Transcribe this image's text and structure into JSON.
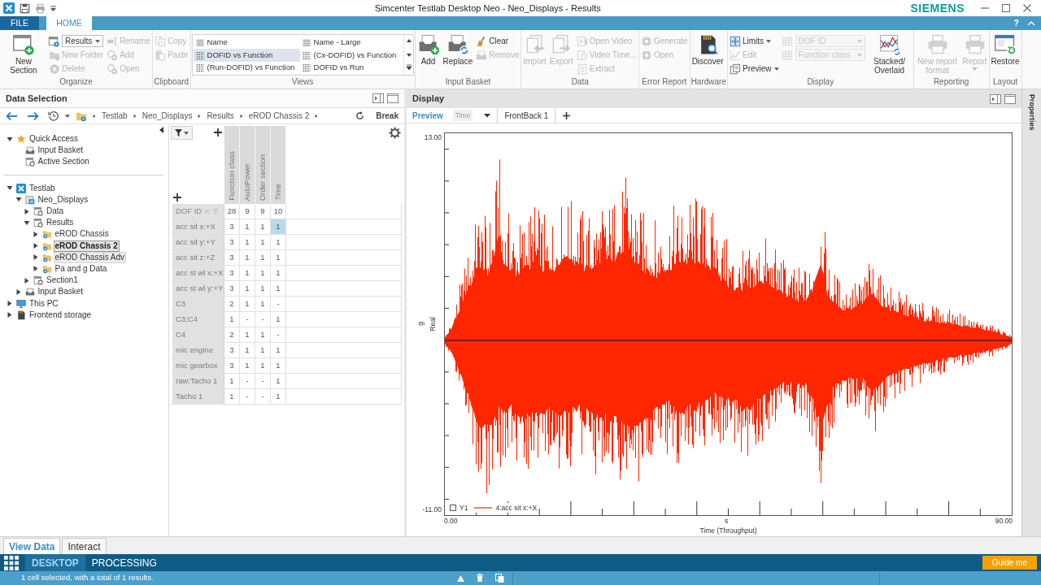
{
  "window": {
    "title": "Simcenter Testlab Desktop Neo - Neo_Displays - Results",
    "brand": "SIEMENS"
  },
  "ribbon": {
    "tabs": [
      {
        "label": "FILE",
        "kind": "file",
        "selected": false
      },
      {
        "label": "HOME",
        "kind": "tab",
        "selected": true
      }
    ],
    "help": "?",
    "groups": [
      {
        "label": "Organize",
        "controls": [
          {
            "kind": "large",
            "label": "New Section",
            "disabled": false
          },
          {
            "kind": "column",
            "items": [
              {
                "kind": "dropdown",
                "value": "Results",
                "disabled": false
              },
              {
                "kind": "small",
                "label": "New Folder",
                "disabled": true
              },
              {
                "kind": "small",
                "label": "Delete",
                "disabled": true
              }
            ]
          },
          {
            "kind": "column",
            "items": [
              {
                "kind": "small",
                "label": "Rename",
                "disabled": true
              },
              {
                "kind": "small",
                "label": "Add",
                "disabled": true
              },
              {
                "kind": "small",
                "label": "Open",
                "disabled": true
              }
            ]
          }
        ]
      },
      {
        "label": "Clipboard",
        "controls": [
          {
            "kind": "column",
            "items": [
              {
                "kind": "small",
                "label": "Copy",
                "disabled": true
              },
              {
                "kind": "small",
                "label": "Paste",
                "disabled": true
              }
            ]
          }
        ]
      },
      {
        "label": "Views",
        "controls": [
          {
            "kind": "gallery",
            "items": [
              {
                "kind": "list",
                "label": "Name",
                "selected": false
              },
              {
                "kind": "list",
                "label": "Name - Large",
                "selected": false
              },
              {
                "kind": "grid",
                "label": "DOFID vs Function",
                "selected": true
              },
              {
                "kind": "grid",
                "label": "(Cx-DOFID) vs Function",
                "selected": false
              },
              {
                "kind": "grid",
                "label": "(Run-DOFID) vs Function",
                "selected": false
              },
              {
                "kind": "grid",
                "label": "DOFID vs Run",
                "selected": false
              }
            ]
          }
        ]
      },
      {
        "label": "Input Basket",
        "controls": [
          {
            "kind": "large",
            "label": "Add",
            "disabled": false
          },
          {
            "kind": "large",
            "label": "Replace",
            "disabled": false
          },
          {
            "kind": "column",
            "items": [
              {
                "kind": "small",
                "label": "Clear",
                "disabled": false
              },
              {
                "kind": "small",
                "label": "Remove",
                "disabled": true
              }
            ]
          }
        ]
      },
      {
        "label": "Data",
        "controls": [
          {
            "kind": "large",
            "label": "Import",
            "disabled": true
          },
          {
            "kind": "large",
            "label": "Export",
            "disabled": true
          },
          {
            "kind": "column",
            "items": [
              {
                "kind": "small",
                "label": "Open Video",
                "disabled": true
              },
              {
                "kind": "small",
                "label": "Video Time...",
                "disabled": true
              },
              {
                "kind": "small",
                "label": "Extract",
                "disabled": true
              }
            ]
          }
        ]
      },
      {
        "label": "Error Report",
        "controls": [
          {
            "kind": "column",
            "items": [
              {
                "kind": "small",
                "label": "Generate",
                "disabled": true
              },
              {
                "kind": "small",
                "label": "Open",
                "disabled": true
              }
            ]
          }
        ]
      },
      {
        "label": "Hardware",
        "controls": [
          {
            "kind": "large",
            "label": "Discover",
            "disabled": false
          }
        ]
      },
      {
        "label": "Display",
        "controls": [
          {
            "kind": "column",
            "items": [
              {
                "kind": "small",
                "label": "Limits",
                "menu": true,
                "disabled": false
              },
              {
                "kind": "small",
                "label": "Edit",
                "menu": false,
                "disabled": true
              },
              {
                "kind": "small",
                "label": "Preview",
                "menu": true,
                "disabled": false
              }
            ]
          },
          {
            "kind": "column",
            "items": [
              {
                "kind": "dropdown",
                "value": "DOF ID",
                "disabled": true
              },
              {
                "kind": "dropdown",
                "value": "Function class",
                "disabled": true
              }
            ]
          },
          {
            "kind": "large",
            "label": "Stacked/ Overlaid",
            "disabled": false
          }
        ]
      },
      {
        "label": "Reporting",
        "controls": [
          {
            "kind": "large",
            "label": "New report format",
            "menu": false,
            "disabled": true
          },
          {
            "kind": "large",
            "label": "Report",
            "menu": true,
            "disabled": true
          }
        ]
      },
      {
        "label": "Layout",
        "controls": [
          {
            "kind": "large",
            "label": "Restore",
            "disabled": false
          }
        ]
      }
    ]
  },
  "data_selection": {
    "title": "Data Selection",
    "breadcrumb": [
      "Testlab",
      "Neo_Displays",
      "Results",
      "eROD Chassis 2"
    ],
    "break_button": "Break",
    "quick_access": [
      {
        "label": "Quick Access",
        "kind": "favorites",
        "expanded": true,
        "selected": false,
        "hovered": false,
        "children": [
          {
            "label": "Input Basket",
            "kind": "basket",
            "selected": false,
            "hovered": false
          },
          {
            "label": "Active Section",
            "kind": "section",
            "selected": false,
            "hovered": false
          }
        ]
      }
    ],
    "tree": [
      {
        "label": "Testlab",
        "kind": "app",
        "expanded": true,
        "selected": false,
        "hovered": false,
        "children": [
          {
            "label": "Neo_Displays",
            "kind": "project",
            "expanded": true,
            "selected": false,
            "hovered": false,
            "children": [
              {
                "label": "Data",
                "kind": "section",
                "expanded": false,
                "selected": false,
                "hovered": false
              },
              {
                "label": "Results",
                "kind": "section",
                "expanded": true,
                "selected": false,
                "hovered": false,
                "children": [
                  {
                    "label": "eROD Chassis",
                    "kind": "folder",
                    "expanded": false,
                    "selected": false,
                    "hovered": false
                  },
                  {
                    "label": "eROD Chassis 2",
                    "kind": "folder",
                    "expanded": false,
                    "selected": true,
                    "hovered": false
                  },
                  {
                    "label": "eROD Chassis Adv",
                    "kind": "folder",
                    "expanded": false,
                    "selected": false,
                    "hovered": true
                  },
                  {
                    "label": "Pa and g Data",
                    "kind": "folder",
                    "expanded": false,
                    "selected": false,
                    "hovered": false
                  }
                ]
              },
              {
                "label": "Section1",
                "kind": "section",
                "expanded": false,
                "selected": false,
                "hovered": false
              }
            ]
          },
          {
            "label": "Input Basket",
            "kind": "basket",
            "expanded": false,
            "selected": false,
            "hovered": false
          }
        ]
      },
      {
        "label": "This PC",
        "kind": "computer",
        "expanded": false,
        "selected": false,
        "hovered": false
      },
      {
        "label": "Frontend storage",
        "kind": "storage",
        "expanded": false,
        "selected": false,
        "hovered": false
      }
    ],
    "table": {
      "row_header": "DOF ID",
      "columns": [
        {
          "label": "Function class",
          "count": "28"
        },
        {
          "label": "AutoPower",
          "count": "9"
        },
        {
          "label": "Order section",
          "count": "9"
        },
        {
          "label": "Time",
          "count": "10"
        }
      ],
      "rows": [
        {
          "label": "acc sit x:+X",
          "cells": [
            {
              "value": "3",
              "selected": false
            },
            {
              "value": "1",
              "selected": false
            },
            {
              "value": "1",
              "selected": false
            },
            {
              "value": "1",
              "selected": true
            }
          ]
        },
        {
          "label": "acc sit y:+Y",
          "cells": [
            {
              "value": "3",
              "selected": false
            },
            {
              "value": "1",
              "selected": false
            },
            {
              "value": "1",
              "selected": false
            },
            {
              "value": "1",
              "selected": false
            }
          ]
        },
        {
          "label": "acc sit z:+Z",
          "cells": [
            {
              "value": "3",
              "selected": false
            },
            {
              "value": "1",
              "selected": false
            },
            {
              "value": "1",
              "selected": false
            },
            {
              "value": "1",
              "selected": false
            }
          ]
        },
        {
          "label": "acc st wl x:+X",
          "cells": [
            {
              "value": "3",
              "selected": false
            },
            {
              "value": "1",
              "selected": false
            },
            {
              "value": "1",
              "selected": false
            },
            {
              "value": "1",
              "selected": false
            }
          ]
        },
        {
          "label": "acc st wl y:+Y",
          "cells": [
            {
              "value": "3",
              "selected": false
            },
            {
              "value": "1",
              "selected": false
            },
            {
              "value": "1",
              "selected": false
            },
            {
              "value": "1",
              "selected": false
            }
          ]
        },
        {
          "label": "C3",
          "cells": [
            {
              "value": "2",
              "selected": false
            },
            {
              "value": "1",
              "selected": false
            },
            {
              "value": "1",
              "selected": false
            },
            {
              "value": "-",
              "selected": false
            }
          ]
        },
        {
          "label": "C3;C4",
          "cells": [
            {
              "value": "1",
              "selected": false
            },
            {
              "value": "-",
              "selected": false
            },
            {
              "value": "-",
              "selected": false
            },
            {
              "value": "1",
              "selected": false
            }
          ]
        },
        {
          "label": "C4",
          "cells": [
            {
              "value": "2",
              "selected": false
            },
            {
              "value": "1",
              "selected": false
            },
            {
              "value": "1",
              "selected": false
            },
            {
              "value": "-",
              "selected": false
            }
          ]
        },
        {
          "label": "mic engine",
          "cells": [
            {
              "value": "3",
              "selected": false
            },
            {
              "value": "1",
              "selected": false
            },
            {
              "value": "1",
              "selected": false
            },
            {
              "value": "1",
              "selected": false
            }
          ]
        },
        {
          "label": "mic gearbox",
          "cells": [
            {
              "value": "3",
              "selected": false
            },
            {
              "value": "1",
              "selected": false
            },
            {
              "value": "1",
              "selected": false
            },
            {
              "value": "1",
              "selected": false
            }
          ]
        },
        {
          "label": "raw:Tacho 1",
          "cells": [
            {
              "value": "1",
              "selected": false
            },
            {
              "value": "-",
              "selected": false
            },
            {
              "value": "-",
              "selected": false
            },
            {
              "value": "1",
              "selected": false
            }
          ]
        },
        {
          "label": "Tacho 1",
          "cells": [
            {
              "value": "1",
              "selected": false
            },
            {
              "value": "-",
              "selected": false
            },
            {
              "value": "-",
              "selected": false
            },
            {
              "value": "1",
              "selected": false
            }
          ]
        }
      ]
    }
  },
  "display": {
    "title": "Display",
    "preview_toggle": {
      "label": "Preview",
      "selected": true
    },
    "domain_dropdown": {
      "value": "Time",
      "disabled": true
    },
    "tabs": [
      {
        "label": "FrontBack 1",
        "selected": true
      }
    ],
    "plot": {
      "y_max": "13.00",
      "y_min": "-11.00",
      "y_unit": "g",
      "y_title": "Real",
      "x_start": "0.00",
      "x_end": "90.00",
      "x_unit": "s",
      "x_title": "Time (Throughput)",
      "legend": [
        {
          "axis": "Y1",
          "checked": false,
          "label": "4:acc sit x:+X"
        }
      ]
    }
  },
  "side_panel": {
    "label": "Properties"
  },
  "view_tabs": [
    {
      "label": "View Data",
      "selected": true
    },
    {
      "label": "Interact",
      "selected": false
    }
  ],
  "workspaces": [
    {
      "label": "DESKTOP",
      "selected": true
    },
    {
      "label": "PROCESSING",
      "selected": false
    }
  ],
  "guide_button": "Guide me",
  "status_bar": {
    "message": "1 cell selected, with a total of 1 results."
  }
}
